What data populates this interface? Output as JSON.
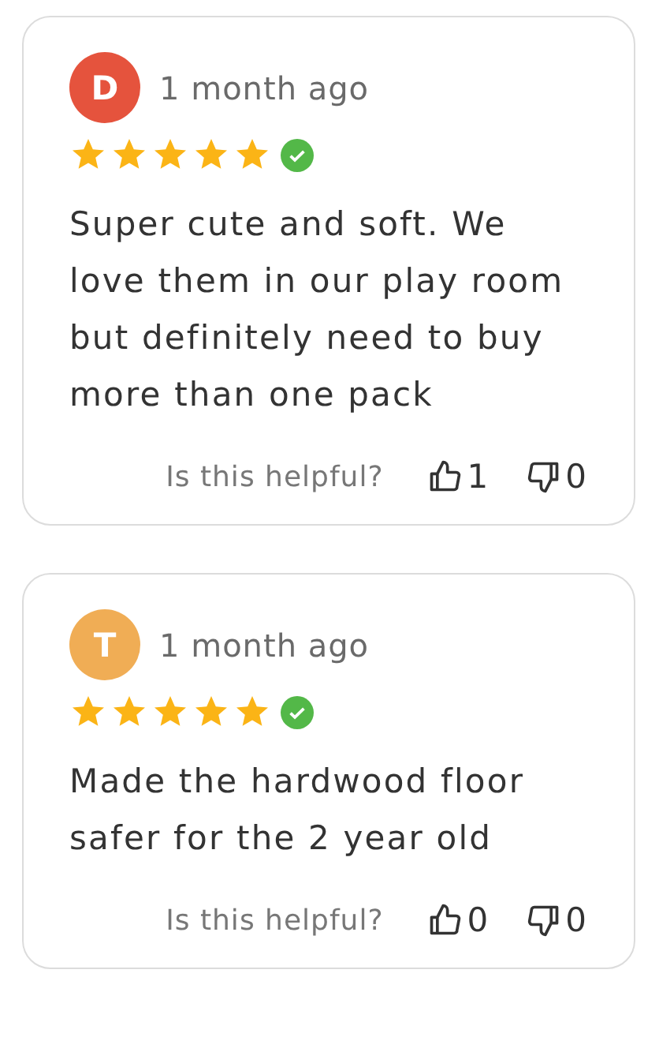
{
  "reviews": [
    {
      "initial": "D",
      "color": "#e5533d",
      "time": "1 month ago",
      "stars": 5,
      "verified": true,
      "text": "Super cute and soft. We love them in our play room but definitely need to buy more than one pack",
      "helpful_prompt": "Is this helpful?",
      "upvotes": "1",
      "downvotes": "0"
    },
    {
      "initial": "T",
      "color": "#f0ad55",
      "time": "1 month ago",
      "stars": 5,
      "verified": true,
      "text": "Made the hardwood floor safer for the 2 year old",
      "helpful_prompt": "Is this helpful?",
      "upvotes": "0",
      "downvotes": "0"
    }
  ]
}
